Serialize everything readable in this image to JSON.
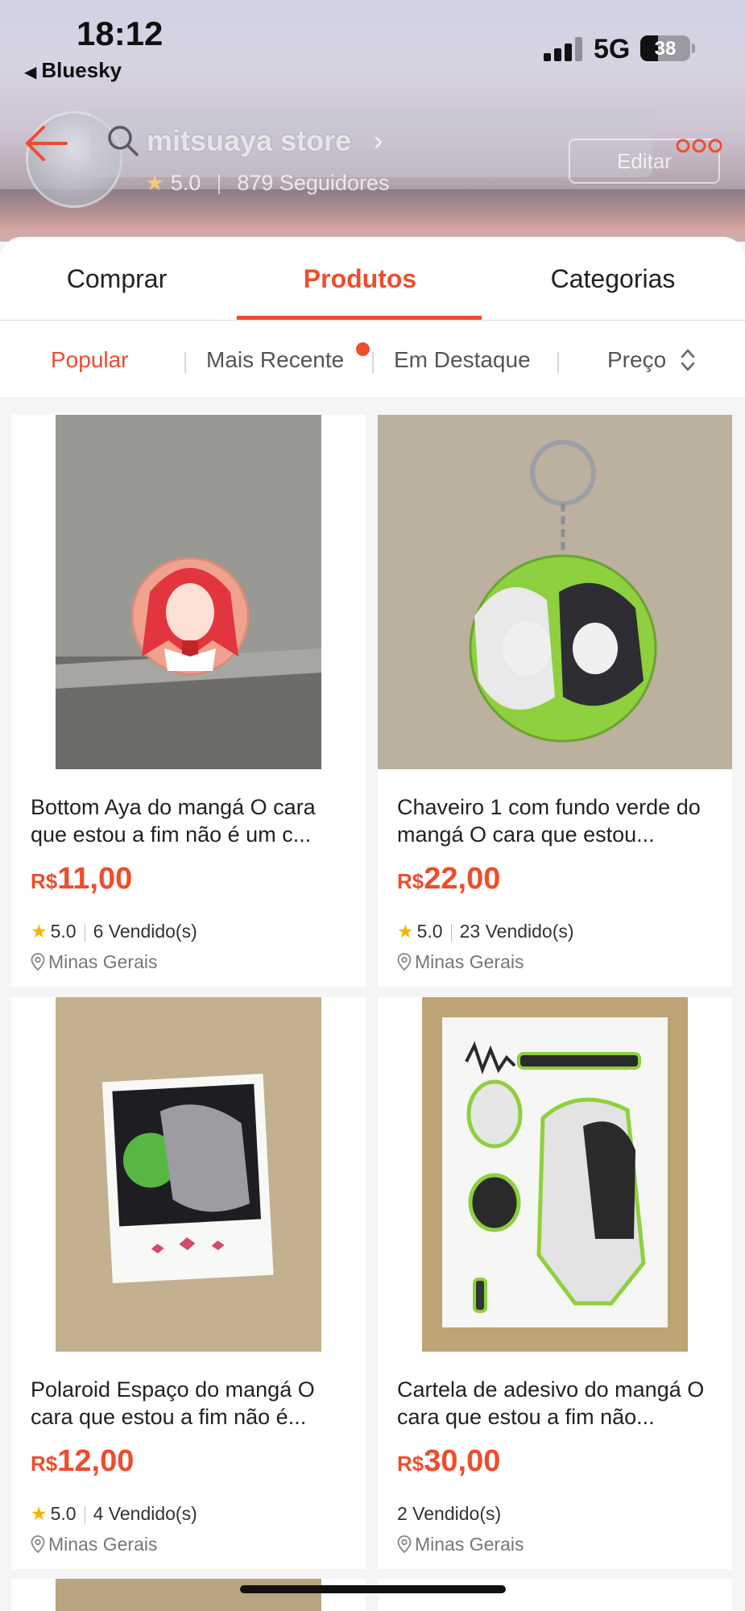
{
  "status_bar": {
    "time": "18:12",
    "back_app": "Bluesky",
    "network": "5G",
    "battery": "38"
  },
  "header": {
    "store_name": "mitsuaya store",
    "rating": "5.0",
    "followers": "879 Seguidores",
    "edit_label": "Editar"
  },
  "tabs": [
    {
      "label": "Comprar"
    },
    {
      "label": "Produtos",
      "active": true
    },
    {
      "label": "Categorias"
    }
  ],
  "filters": [
    {
      "label": "Popular",
      "active": true
    },
    {
      "label": "Mais Recente"
    },
    {
      "label": "Em Destaque"
    },
    {
      "label": "Preço"
    }
  ],
  "products": [
    {
      "title": "Bottom Aya do mangá O cara que estou a fim não é um c...",
      "currency": "R$",
      "price": "11,00",
      "rating": "5.0",
      "sold": "6 Vendido(s)",
      "location": "Minas Gerais"
    },
    {
      "title": "Chaveiro 1 com fundo verde do mangá O cara que estou...",
      "currency": "R$",
      "price": "22,00",
      "rating": "5.0",
      "sold": "23 Vendido(s)",
      "location": "Minas Gerais"
    },
    {
      "title": "Polaroid Espaço do mangá O cara que estou a fim não é...",
      "currency": "R$",
      "price": "12,00",
      "rating": "5.0",
      "sold": "4 Vendido(s)",
      "location": "Minas Gerais"
    },
    {
      "title": "Cartela de adesivo do mangá O cara que estou a fim não...",
      "currency": "R$",
      "price": "30,00",
      "sold": "2 Vendido(s)",
      "location": "Minas Gerais"
    }
  ],
  "colors": {
    "accent": "#ee4d2d",
    "star": "#f5b400"
  }
}
